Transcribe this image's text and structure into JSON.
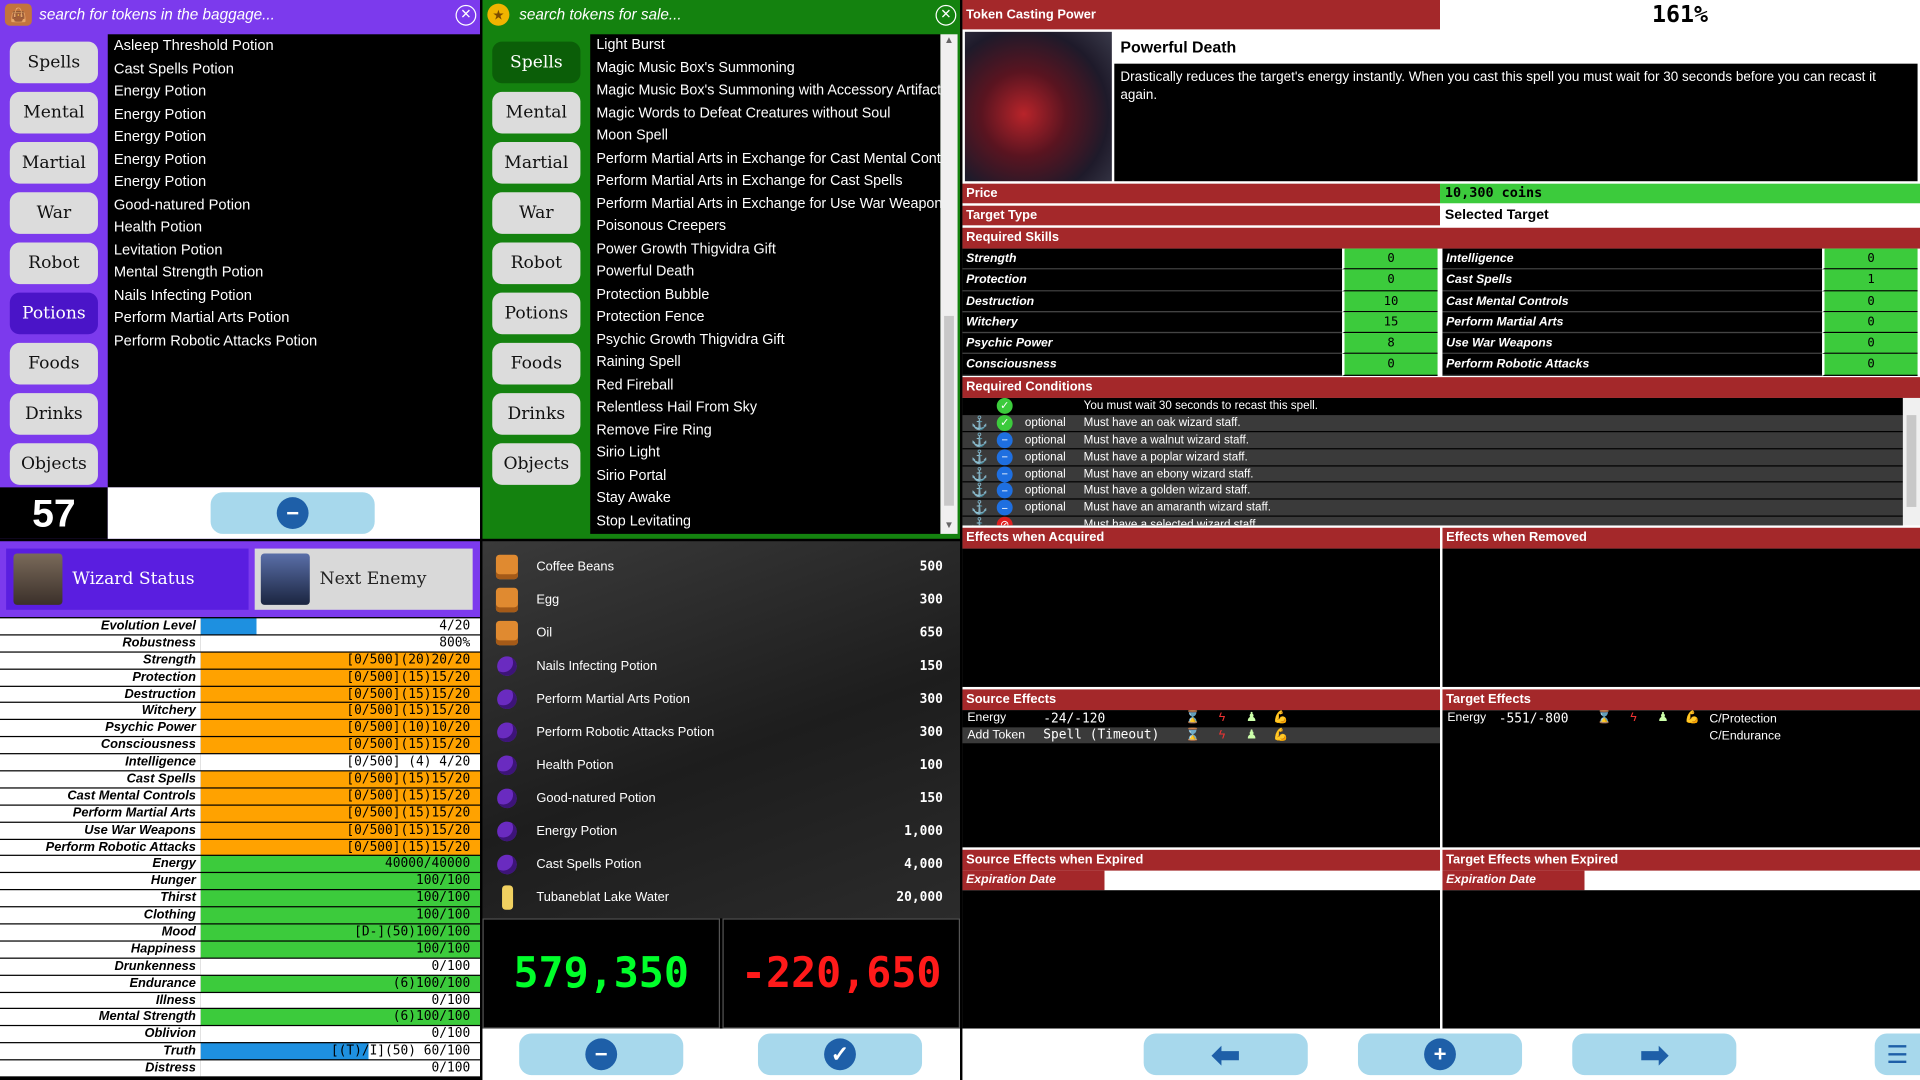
{
  "left_panel": {
    "search_placeholder": "search for tokens in the baggage...",
    "categories": [
      "Spells",
      "Mental",
      "Martial",
      "War",
      "Robot",
      "Potions",
      "Foods",
      "Drinks",
      "Objects"
    ],
    "active_category": "Potions",
    "items": [
      "Asleep Threshold Potion",
      "Cast Spells Potion",
      "Energy Potion",
      "Energy Potion",
      "Energy Potion",
      "Energy Potion",
      "Energy Potion",
      "Good-natured Potion",
      "Health Potion",
      "Levitation Potion",
      "Mental Strength Potion",
      "Nails Infecting Potion",
      "Perform Martial Arts Potion",
      "Perform Robotic Attacks Potion"
    ],
    "count": "57"
  },
  "shop_panel": {
    "search_placeholder": "search tokens for sale...",
    "categories": [
      "Spells",
      "Mental",
      "Martial",
      "War",
      "Robot",
      "Potions",
      "Foods",
      "Drinks",
      "Objects"
    ],
    "active_category": "Spells",
    "items": [
      "Light Burst",
      "Magic Music Box's Summoning",
      "Magic Music Box's Summoning with Accessory Artifact",
      "Magic Words to Defeat Creatures without Soul",
      "Moon Spell",
      "Perform Martial Arts in Exchange for Cast Mental Contr",
      "Perform Martial Arts in Exchange for Cast Spells",
      "Perform Martial Arts in Exchange for Use War Weapons",
      "Poisonous Creepers",
      "Power Growth Thigvidra Gift",
      "Powerful Death",
      "Protection Bubble",
      "Protection Fence",
      "Psychic Growth Thigvidra Gift",
      "Raining Spell",
      "Red Fireball",
      "Relentless Hail From Sky",
      "Remove Fire Ring",
      "Sirio Light",
      "Sirio Portal",
      "Stay Awake",
      "Stop Levitating"
    ]
  },
  "status": {
    "wizard_tab": "Wizard Status",
    "enemy_tab": "Next Enemy",
    "rows": [
      {
        "label": "Evolution Level",
        "value": "4/20",
        "bar": "blue",
        "fill": 0.2
      },
      {
        "label": "Robustness",
        "value": "800%",
        "bar": "none",
        "fill": 0
      },
      {
        "label": "Strength",
        "value": "[0/500](20)20/20",
        "bar": "orange",
        "fill": 1
      },
      {
        "label": "Protection",
        "value": "[0/500](15)15/20",
        "bar": "orange",
        "fill": 1
      },
      {
        "label": "Destruction",
        "value": "[0/500](15)15/20",
        "bar": "orange",
        "fill": 1
      },
      {
        "label": "Witchery",
        "value": "[0/500](15)15/20",
        "bar": "orange",
        "fill": 1
      },
      {
        "label": "Psychic Power",
        "value": "[0/500](10)10/20",
        "bar": "orange",
        "fill": 1
      },
      {
        "label": "Consciousness",
        "value": "[0/500](15)15/20",
        "bar": "orange",
        "fill": 1
      },
      {
        "label": "Intelligence",
        "value": "[0/500] (4) 4/20",
        "bar": "none",
        "fill": 0
      },
      {
        "label": "Cast Spells",
        "value": "[0/500](15)15/20",
        "bar": "orange",
        "fill": 1
      },
      {
        "label": "Cast Mental Controls",
        "value": "[0/500](15)15/20",
        "bar": "orange",
        "fill": 1
      },
      {
        "label": "Perform Martial Arts",
        "value": "[0/500](15)15/20",
        "bar": "orange",
        "fill": 1
      },
      {
        "label": "Use War Weapons",
        "value": "[0/500](15)15/20",
        "bar": "orange",
        "fill": 1
      },
      {
        "label": "Perform Robotic Attacks",
        "value": "[0/500](15)15/20",
        "bar": "orange",
        "fill": 1
      },
      {
        "label": "Energy",
        "value": "40000/40000",
        "bar": "green",
        "fill": 1
      },
      {
        "label": "Hunger",
        "value": "100/100",
        "bar": "green",
        "fill": 1
      },
      {
        "label": "Thirst",
        "value": "100/100",
        "bar": "green",
        "fill": 1
      },
      {
        "label": "Clothing",
        "value": "100/100",
        "bar": "green",
        "fill": 1
      },
      {
        "label": "Mood",
        "value": "[D-](50)100/100",
        "bar": "green",
        "fill": 1
      },
      {
        "label": "Happiness",
        "value": "100/100",
        "bar": "green",
        "fill": 1
      },
      {
        "label": "Drunkenness",
        "value": "0/100",
        "bar": "none",
        "fill": 0
      },
      {
        "label": "Endurance",
        "value": "(6)100/100",
        "bar": "green",
        "fill": 1
      },
      {
        "label": "Illness",
        "value": "0/100",
        "bar": "none",
        "fill": 0
      },
      {
        "label": "Mental Strength",
        "value": "(6)100/100",
        "bar": "green",
        "fill": 1
      },
      {
        "label": "Oblivion",
        "value": "0/100",
        "bar": "none",
        "fill": 0
      },
      {
        "label": "Truth",
        "value": "[(T)/I](50) 60/100",
        "bar": "blue",
        "fill": 0.6
      },
      {
        "label": "Distress",
        "value": "0/100",
        "bar": "none",
        "fill": 0
      }
    ]
  },
  "sale_list": [
    {
      "name": "Coffee Beans",
      "price": "500",
      "icon": "food-bag-icon"
    },
    {
      "name": "Egg",
      "price": "300",
      "icon": "food-bag-icon"
    },
    {
      "name": "Oil",
      "price": "650",
      "icon": "food-bag-icon"
    },
    {
      "name": "Nails Infecting Potion",
      "price": "150",
      "icon": "potion-icon"
    },
    {
      "name": "Perform Martial Arts Potion",
      "price": "300",
      "icon": "potion-icon"
    },
    {
      "name": "Perform Robotic Attacks Potion",
      "price": "300",
      "icon": "potion-icon"
    },
    {
      "name": "Health Potion",
      "price": "100",
      "icon": "potion-icon"
    },
    {
      "name": "Good-natured Potion",
      "price": "150",
      "icon": "potion-icon"
    },
    {
      "name": "Energy Potion",
      "price": "1,000",
      "icon": "potion-icon"
    },
    {
      "name": "Cast Spells Potion",
      "price": "4,000",
      "icon": "potion-icon"
    },
    {
      "name": "Tubaneblat Lake Water",
      "price": "20,000",
      "icon": "bottle-icon"
    }
  ],
  "totals": {
    "balance": "579,350",
    "diff": "-220,650"
  },
  "detail": {
    "casting_label": "Token Casting Power",
    "casting_value": "161%",
    "name": "Powerful Death",
    "description": "Drastically reduces the target's energy instantly. When you cast this spell you must wait for 30 seconds before you can recast it again.",
    "price_label": "Price",
    "price_value": "10,300 coins",
    "target_label": "Target Type",
    "target_value": "Selected Target",
    "skills_title": "Required Skills",
    "skills_left": [
      [
        "Strength",
        "0"
      ],
      [
        "Protection",
        "0"
      ],
      [
        "Destruction",
        "10"
      ],
      [
        "Witchery",
        "15"
      ],
      [
        "Psychic Power",
        "8"
      ],
      [
        "Consciousness",
        "0"
      ]
    ],
    "skills_right": [
      [
        "Intelligence",
        "0"
      ],
      [
        "Cast Spells",
        "1"
      ],
      [
        "Cast Mental Controls",
        "0"
      ],
      [
        "Perform Martial Arts",
        "0"
      ],
      [
        "Use War Weapons",
        "0"
      ],
      [
        "Perform Robotic Attacks",
        "0"
      ]
    ],
    "conditions_title": "Required Conditions",
    "conditions": [
      {
        "opt": "",
        "text": "You must wait 30 seconds to recast this spell.",
        "state": "ok"
      },
      {
        "opt": "optional",
        "text": "Must have an oak wizard staff.",
        "state": "ok"
      },
      {
        "opt": "optional",
        "text": "Must have a walnut wizard staff.",
        "state": "minus"
      },
      {
        "opt": "optional",
        "text": "Must have a poplar wizard staff.",
        "state": "minus"
      },
      {
        "opt": "optional",
        "text": "Must have an ebony wizard staff.",
        "state": "minus"
      },
      {
        "opt": "optional",
        "text": "Must have a golden wizard staff.",
        "state": "minus"
      },
      {
        "opt": "optional",
        "text": "Must have an amaranth wizard staff.",
        "state": "minus"
      },
      {
        "opt": "",
        "text": "Must have a selected wizard staff.",
        "state": "no"
      }
    ],
    "acquired_title": "Effects when Acquired",
    "removed_title": "Effects when Removed",
    "source_title": "Source Effects",
    "target_title": "Target Effects",
    "source_effects": [
      [
        "Energy",
        "-24/-120"
      ],
      [
        "Add Token",
        "Spell (Timeout)"
      ]
    ],
    "target_effects": [
      [
        "Energy",
        "-551/-800",
        "C/Protection",
        "C/Endurance"
      ]
    ],
    "source_expired_title": "Source Effects when Expired",
    "target_expired_title": "Target Effects when Expired",
    "expiration_label": "Expiration Date"
  },
  "colors": {
    "purple": "#7c3aed",
    "green": "#14820f",
    "orange": "#ffa200",
    "bar_green": "#3ccb3c",
    "blue": "#1e90e0",
    "red_header": "#a4282a"
  }
}
